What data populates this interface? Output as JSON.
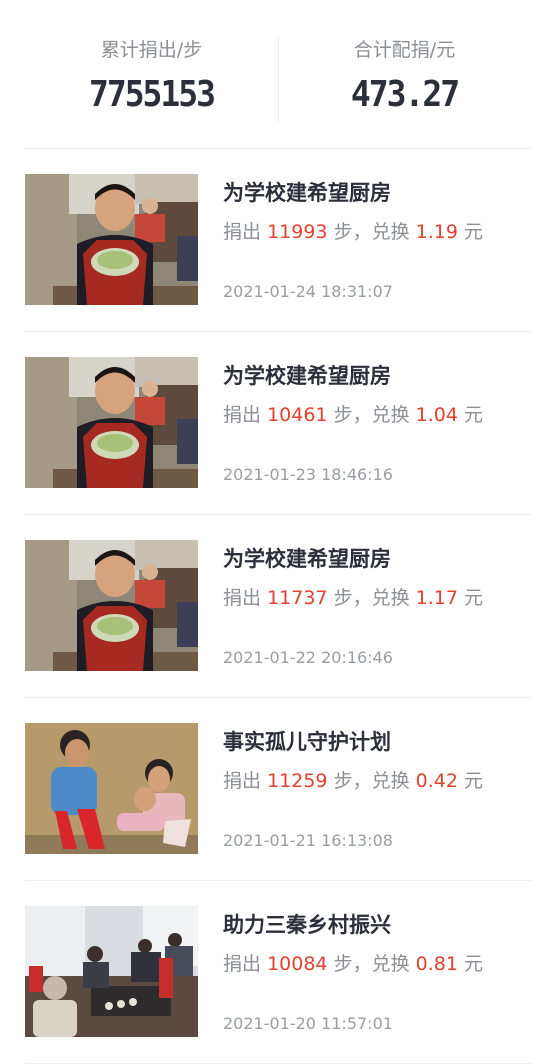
{
  "summary": {
    "steps_label": "累计捐出/步",
    "steps_value": "7755153",
    "amount_label": "合计配捐/元",
    "amount_value": "473.27"
  },
  "donation_text": {
    "prefix": "捐出",
    "steps_unit": "步，兑换",
    "money_unit": "元"
  },
  "colors": {
    "accent": "#e2412f",
    "text_primary": "#2b2f3a",
    "text_secondary": "#8c8f96"
  },
  "records": [
    {
      "title": "为学校建希望厨房",
      "steps": "11993",
      "amount": "1.19",
      "time": "2021-01-24 18:31:07",
      "photo": "kitchen-boy-photo"
    },
    {
      "title": "为学校建希望厨房",
      "steps": "10461",
      "amount": "1.04",
      "time": "2021-01-23 18:46:16",
      "photo": "kitchen-boy-photo"
    },
    {
      "title": "为学校建希望厨房",
      "steps": "11737",
      "amount": "1.17",
      "time": "2021-01-22 20:16:46",
      "photo": "kitchen-boy-photo"
    },
    {
      "title": "事实孤儿守护计划",
      "steps": "11259",
      "amount": "0.42",
      "time": "2021-01-21 16:13:08",
      "photo": "orphan-children-photo"
    },
    {
      "title": "助力三秦乡村振兴",
      "steps": "10084",
      "amount": "0.81",
      "time": "2021-01-20 11:57:01",
      "photo": "village-elders-photo"
    }
  ]
}
